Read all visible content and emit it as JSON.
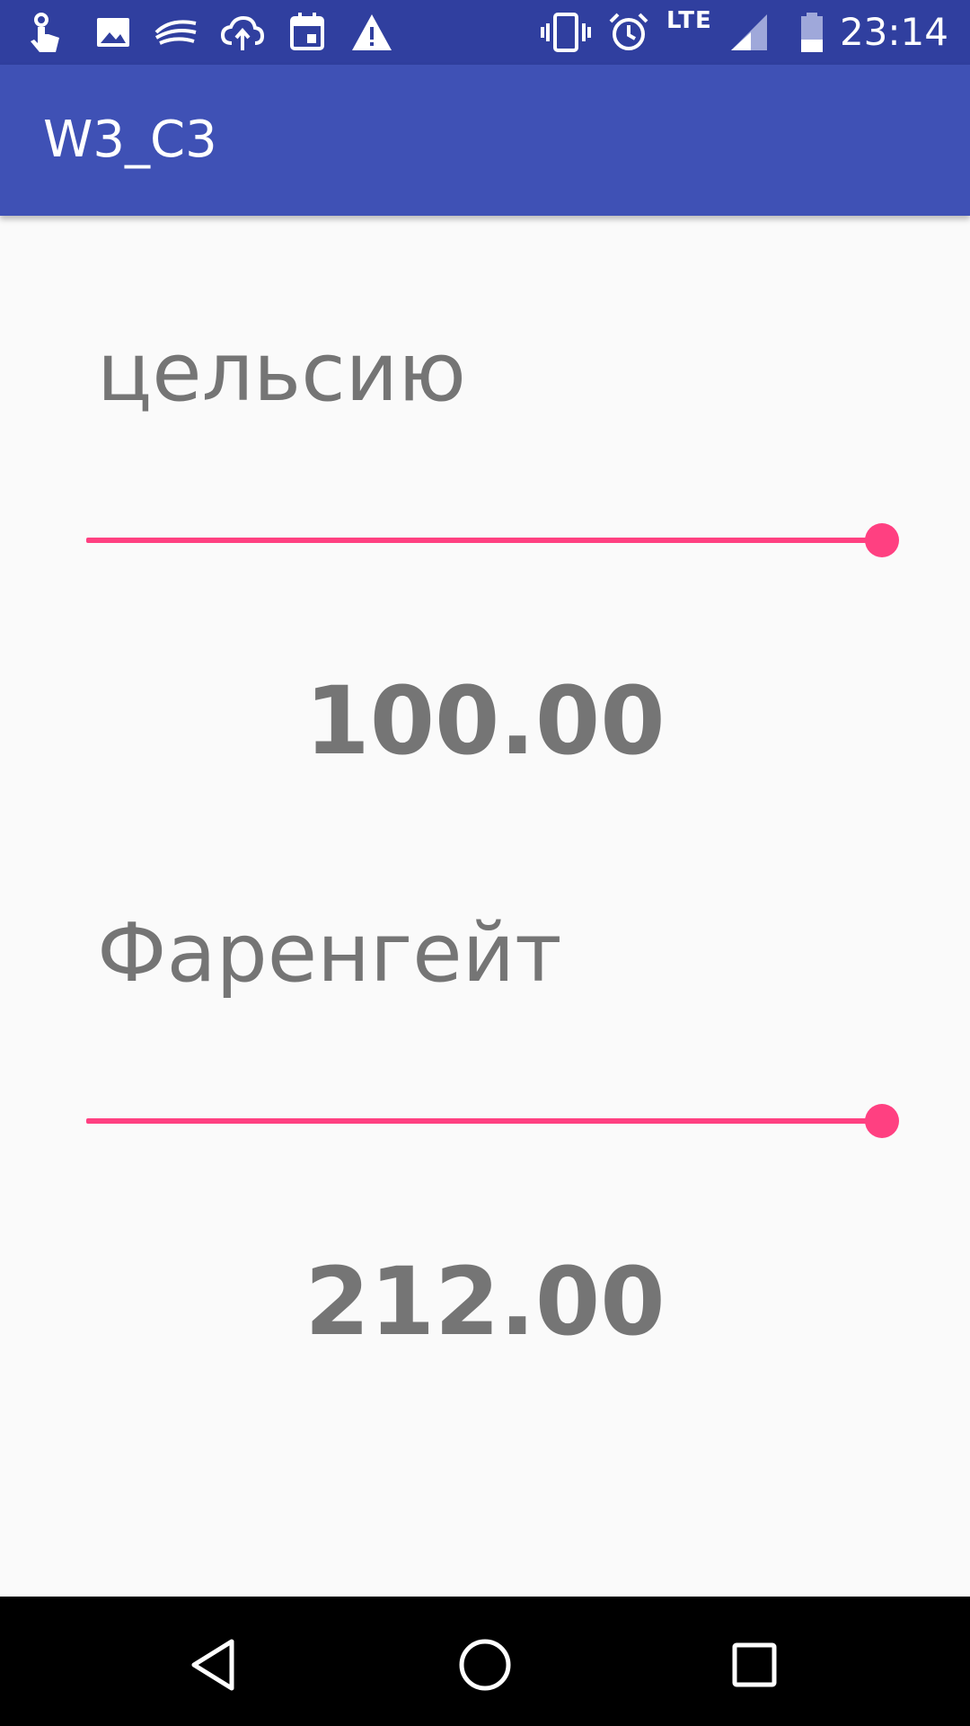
{
  "status_bar": {
    "icons": [
      "touch-icon",
      "image-icon",
      "swiftkey-icon",
      "cloud-upload-icon",
      "calendar-icon",
      "warning-icon",
      "vibrate-icon",
      "alarm-icon",
      "signal-icon",
      "battery-icon"
    ],
    "network": "LTE",
    "time": "23:14"
  },
  "app_bar": {
    "title": "W3_C3"
  },
  "celsius": {
    "label": "цельсию",
    "value": "100.00",
    "slider_fraction": 1.0
  },
  "fahrenheit": {
    "label": "Фаренгейт",
    "value": "212.00",
    "slider_fraction": 1.0
  },
  "colors": {
    "status_bar": "#303f9f",
    "app_bar": "#3f51b5",
    "accent": "#ff4081",
    "text": "#757575",
    "background": "#fafafa"
  },
  "nav_bar": {
    "icons": [
      "back-icon",
      "home-icon",
      "recents-icon"
    ]
  }
}
